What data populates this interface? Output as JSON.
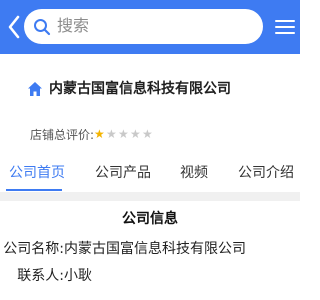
{
  "search": {
    "placeholder": "搜索"
  },
  "company": {
    "name": "内蒙古国富信息科技有限公司",
    "rating_label": "店铺总评价:",
    "rating": 1,
    "rating_max": 5
  },
  "tabs": [
    {
      "label": "公司首页",
      "active": true
    },
    {
      "label": "公司产品",
      "active": false
    },
    {
      "label": "视频",
      "active": false
    },
    {
      "label": "公司介绍",
      "active": false
    }
  ],
  "info": {
    "title": "公司信息",
    "rows": [
      {
        "label": "公司名称:",
        "value": "内蒙古国富信息科技有限公司"
      },
      {
        "label": "联系人:",
        "value": "小耿"
      }
    ]
  },
  "colors": {
    "accent": "#3e7bf2",
    "star": "#f4b400"
  }
}
